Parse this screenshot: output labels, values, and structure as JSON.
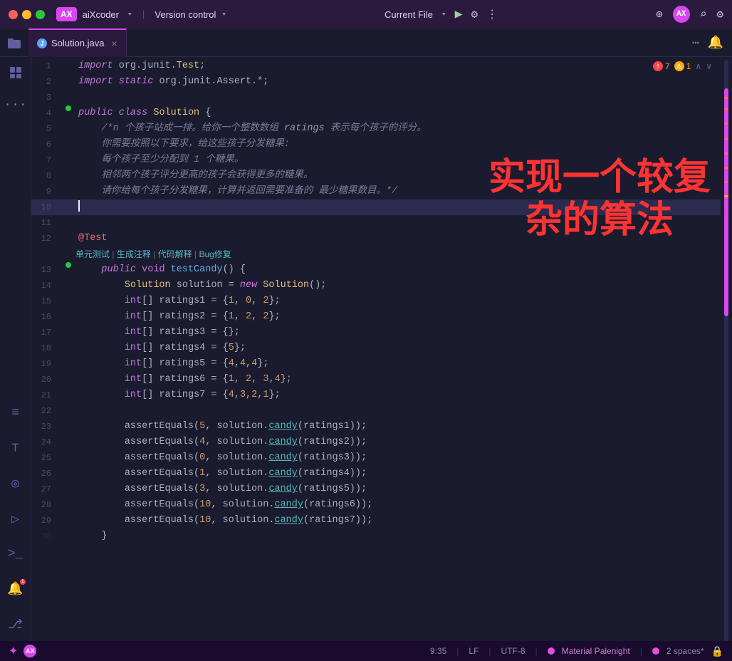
{
  "titlebar": {
    "app_logo": "AX",
    "app_name": "aiXcoder",
    "app_chevron": "▾",
    "version_control": "Version control",
    "version_chevron": "▾",
    "current_file": "Current File",
    "current_file_chevron": "▾",
    "run_icon": "▶",
    "bug_icon": "⚙",
    "more_icon": "⋮",
    "add_user_icon": "⊕",
    "avatar_label": "AX",
    "search_icon": "⌕",
    "settings_icon": "⚙"
  },
  "tabbar": {
    "tab_name": "Solution.java",
    "tab_icon_label": "J",
    "more_icon": "⋯",
    "bell_icon": "🔔"
  },
  "editor": {
    "error_count": "7",
    "warning_count": "1",
    "overlay_text": "实现一个较复\n杂的算法",
    "lines": [
      {
        "num": 1,
        "gutter": false,
        "content": "import org.junit.Test;",
        "type": "import"
      },
      {
        "num": 2,
        "gutter": false,
        "content": "import static org.junit.Assert.*;",
        "type": "import"
      },
      {
        "num": 3,
        "gutter": false,
        "content": "",
        "type": "empty"
      },
      {
        "num": 4,
        "gutter": true,
        "content": "public class Solution {",
        "type": "class"
      },
      {
        "num": 5,
        "gutter": false,
        "content": "    /*n 个孩子站成一排。给你一个整数数组 ratings 表示每个孩子的评分。",
        "type": "comment"
      },
      {
        "num": 6,
        "gutter": false,
        "content": "    你需要按照以下要求，给这些孩子分发糖果:",
        "type": "comment"
      },
      {
        "num": 7,
        "gutter": false,
        "content": "    每个孩子至少分配到 1 个糖果。",
        "type": "comment"
      },
      {
        "num": 8,
        "gutter": false,
        "content": "    相邻两个孩子评分更高的孩子会获得更多的糖果。",
        "type": "comment"
      },
      {
        "num": 9,
        "gutter": false,
        "content": "    请你给每个孩子分发糖果，计算并返回需要准备的 最少糖果数目。*/",
        "type": "comment"
      },
      {
        "num": 10,
        "gutter": false,
        "content": "",
        "type": "current",
        "cursor": true
      },
      {
        "num": 11,
        "gutter": false,
        "content": "",
        "type": "empty"
      },
      {
        "num": 12,
        "gutter": false,
        "content": "    @Test\n    单元测试 | 生成注释 | 代码解释 | Bug修复",
        "type": "annotation"
      },
      {
        "num": 13,
        "gutter": true,
        "content": "    public void testCandy() {",
        "type": "method"
      },
      {
        "num": 14,
        "gutter": false,
        "content": "        Solution solution = new Solution();",
        "type": "code"
      },
      {
        "num": 15,
        "gutter": false,
        "content": "        int[] ratings1 = {1, 0, 2};",
        "type": "code"
      },
      {
        "num": 16,
        "gutter": false,
        "content": "        int[] ratings2 = {1, 2, 2};",
        "type": "code"
      },
      {
        "num": 17,
        "gutter": false,
        "content": "        int[] ratings3 = {};",
        "type": "code"
      },
      {
        "num": 18,
        "gutter": false,
        "content": "        int[] ratings4 = {5};",
        "type": "code"
      },
      {
        "num": 19,
        "gutter": false,
        "content": "        int[] ratings5 = {4,4,4};",
        "type": "code"
      },
      {
        "num": 20,
        "gutter": false,
        "content": "        int[] ratings6 = {1, 2, 3,4};",
        "type": "code"
      },
      {
        "num": 21,
        "gutter": false,
        "content": "        int[] ratings7 = {4,3,2,1};",
        "type": "code"
      },
      {
        "num": 22,
        "gutter": false,
        "content": "",
        "type": "empty"
      },
      {
        "num": 23,
        "gutter": false,
        "content": "        assertEquals(5, solution.candy(ratings1));",
        "type": "assert"
      },
      {
        "num": 24,
        "gutter": false,
        "content": "        assertEquals(4, solution.candy(ratings2));",
        "type": "assert"
      },
      {
        "num": 25,
        "gutter": false,
        "content": "        assertEquals(0, solution.candy(ratings3));",
        "type": "assert"
      },
      {
        "num": 26,
        "gutter": false,
        "content": "        assertEquals(1, solution.candy(ratings4));",
        "type": "assert"
      },
      {
        "num": 27,
        "gutter": false,
        "content": "        assertEquals(3, solution.candy(ratings5));",
        "type": "assert"
      },
      {
        "num": 28,
        "gutter": false,
        "content": "        assertEquals(10, solution.candy(ratings6));",
        "type": "assert"
      },
      {
        "num": 29,
        "gutter": false,
        "content": "        assertEquals(10, solution.candy(ratings7));",
        "type": "assert"
      }
    ]
  },
  "statusbar": {
    "time": "9:35",
    "encoding_lf": "LF",
    "encoding_utf": "UTF-8",
    "theme": "Material Palenight",
    "spaces": "2 spaces*",
    "lock_icon": "🔒"
  }
}
